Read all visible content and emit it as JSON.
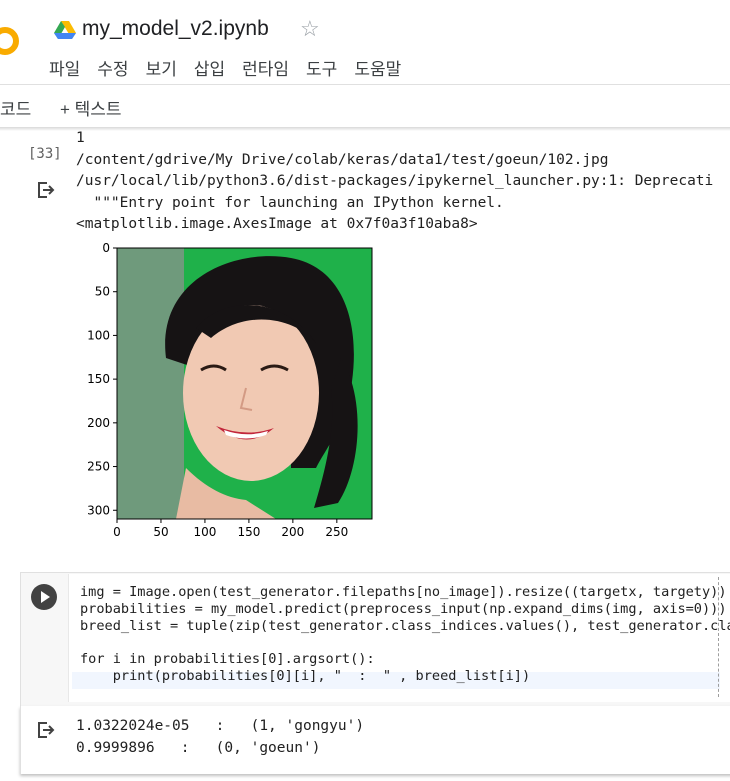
{
  "header": {
    "title": "my_model_v2.ipynb",
    "menu": [
      "파일",
      "수정",
      "보기",
      "삽입",
      "런타임",
      "도구",
      "도움말"
    ]
  },
  "toolbar": {
    "code": "코드",
    "text": "+ 텍스트"
  },
  "cell1": {
    "exec_count": "[33]",
    "output_lines": [
      "1",
      "/content/gdrive/My Drive/colab/keras/data1/test/goeun/102.jpg",
      "/usr/local/lib/python3.6/dist-packages/ipykernel_launcher.py:1: Deprecati",
      "  \"\"\"Entry point for launching an IPython kernel.",
      "<matplotlib.image.AxesImage at 0x7f0a3f10aba8>"
    ]
  },
  "chart_data": {
    "type": "image",
    "xticks": [
      "0",
      "50",
      "100",
      "150",
      "200",
      "250"
    ],
    "yticks": [
      "0",
      "50",
      "100",
      "150",
      "200",
      "250",
      "300"
    ],
    "xlim": [
      0,
      290
    ],
    "ylim": [
      310,
      0
    ]
  },
  "cell2": {
    "code_lines": [
      "img = Image.open(test_generator.filepaths[no_image]).resize((targetx, targety))",
      "probabilities = my_model.predict(preprocess_input(np.expand_dims(img, axis=0)))",
      "breed_list = tuple(zip(test_generator.class_indices.values(), test_generator.class",
      "",
      "for i in probabilities[0].argsort():",
      "    print(probabilities[0][i], \"  :  \" , breed_list[i])"
    ],
    "output_lines": [
      "1.0322024e-05   :   (1, 'gongyu')",
      "0.9999896   :   (0, 'goeun')"
    ]
  },
  "colors": {
    "accent": "#f9ab00",
    "plot_bg": "#1db954"
  }
}
